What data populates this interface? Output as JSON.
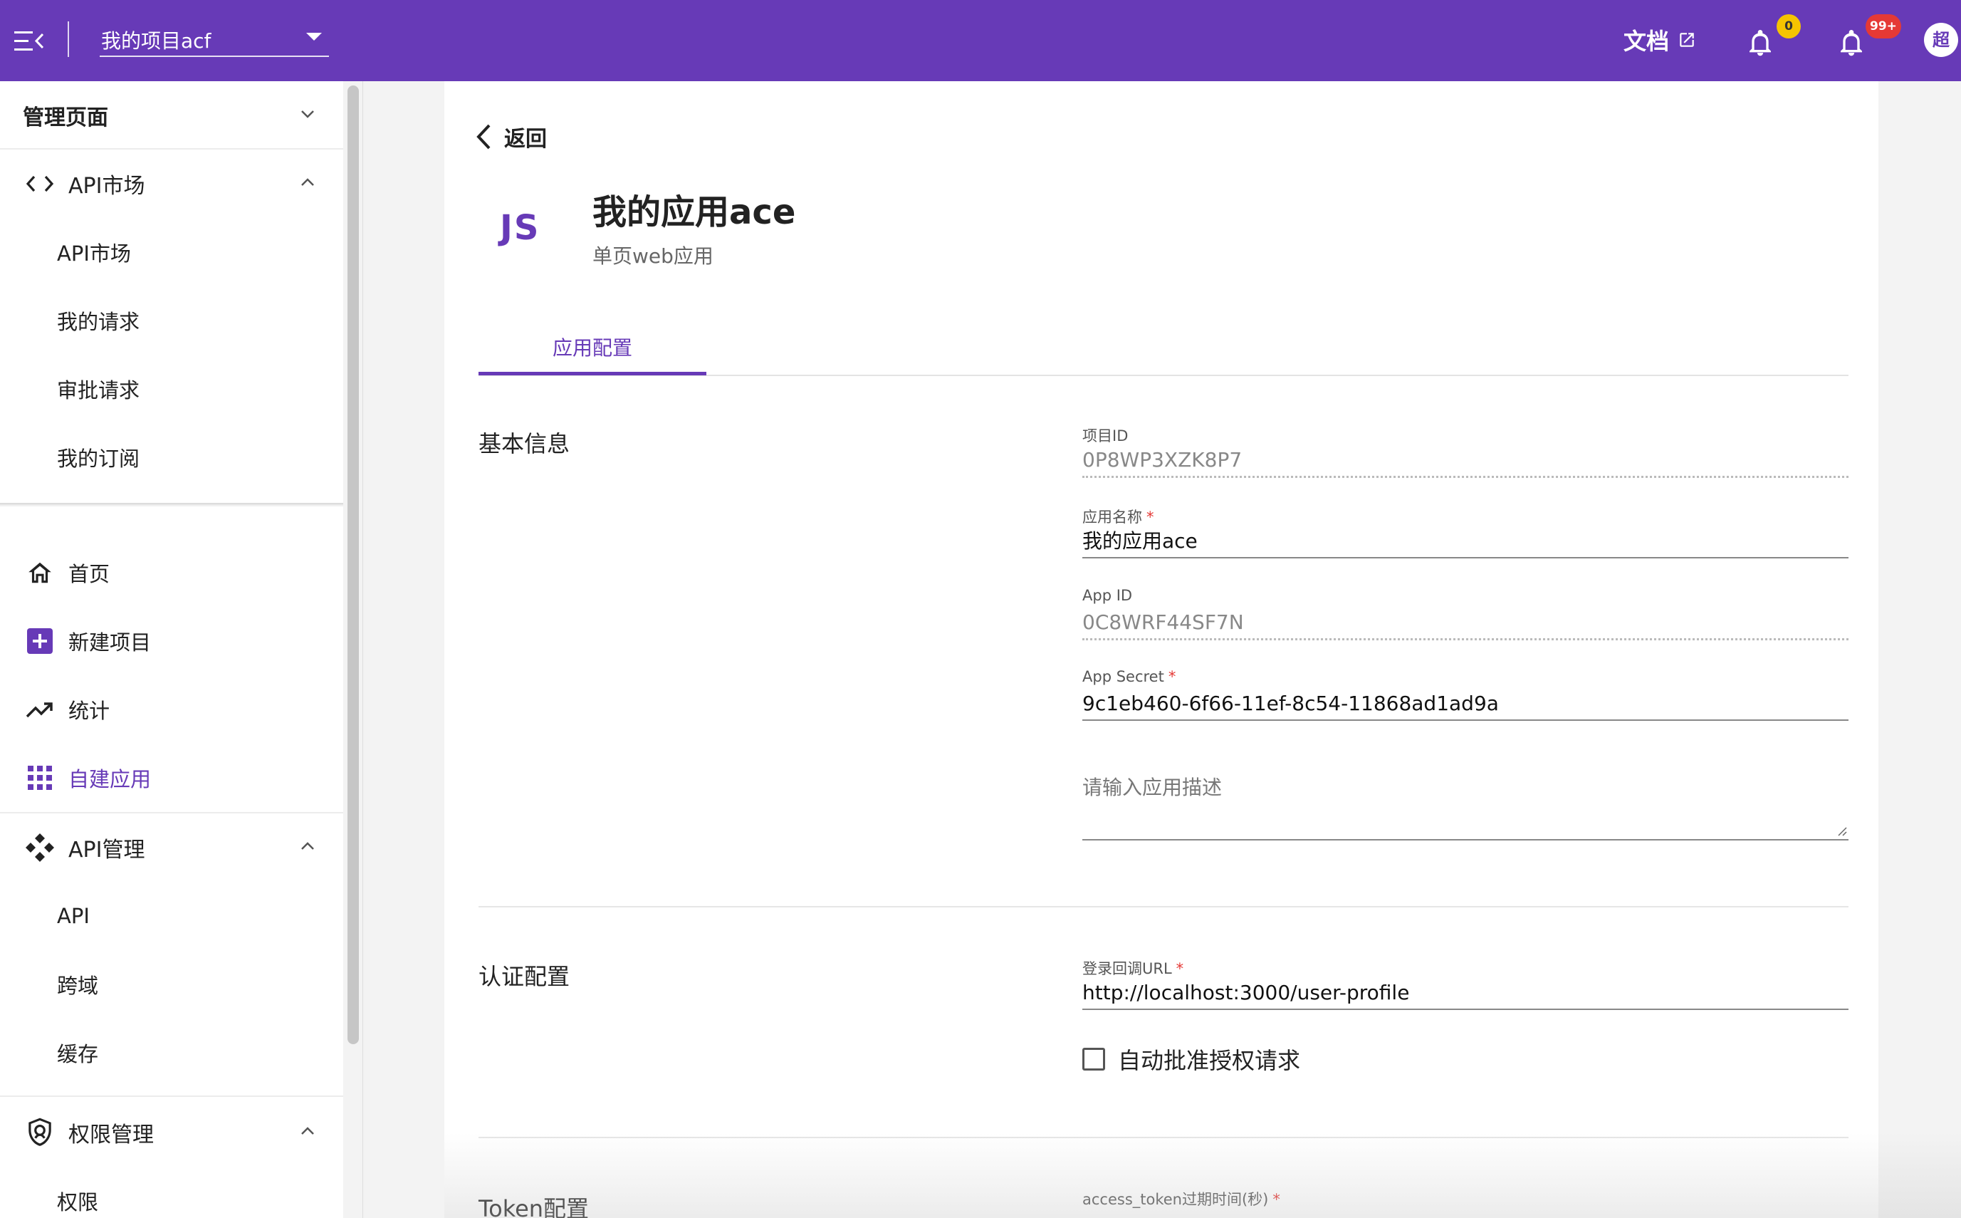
{
  "topbar": {
    "project": "我的项目acf",
    "docs_label": "文档",
    "notification_badge_1": "0",
    "notification_badge_2": "99+",
    "avatar_text": "超",
    "bg_color": "#673ab7"
  },
  "sidebar": {
    "header": "管理页面",
    "api_market_group": "API市场",
    "api_market_items": [
      "API市场",
      "我的请求",
      "审批请求",
      "我的订阅"
    ],
    "nav": {
      "home": "首页",
      "new_project": "新建项目",
      "stats": "统计",
      "custom_apps": "自建应用"
    },
    "api_mgmt_group": "API管理",
    "api_mgmt_items": [
      "API",
      "跨域",
      "缓存"
    ],
    "perm_group": "权限管理",
    "perm_items": [
      "权限"
    ],
    "active_item": "自建应用"
  },
  "main": {
    "back_label": "返回",
    "logo_text": "JS",
    "app_title": "我的应用ace",
    "app_subtitle": "单页web应用",
    "tab_label": "应用配置",
    "basic_section": {
      "title": "基本信息",
      "project_id_label": "项目ID",
      "project_id_value": "0P8WP3XZK8P7",
      "app_name_label": "应用名称",
      "app_name_value": "我的应用ace",
      "app_id_label": "App ID",
      "app_id_value": "0C8WRF44SF7N",
      "app_secret_label": "App Secret",
      "app_secret_value": "9c1eb460-6f66-11ef-8c54-11868ad1ad9a",
      "description_placeholder": "请输入应用描述"
    },
    "auth_section": {
      "title": "认证配置",
      "callback_label": "登录回调URL",
      "callback_value": "http://localhost:3000/user-profile",
      "auto_approve_label": "自动批准授权请求"
    },
    "token_section": {
      "title": "Token配置",
      "access_token_label": "access_token过期时间(秒)"
    }
  },
  "required_mark": "*"
}
